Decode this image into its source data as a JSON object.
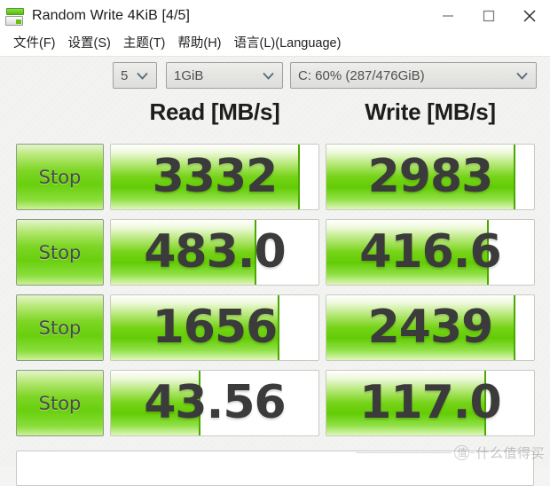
{
  "window": {
    "title": "Random Write 4KiB [4/5]",
    "icon": "disk-drive-icon",
    "controls": {
      "minimize": "minimize-icon",
      "maximize": "maximize-icon",
      "close": "close-icon"
    }
  },
  "menu": {
    "items": [
      {
        "label": "文件(F)"
      },
      {
        "label": "设置(S)"
      },
      {
        "label": "主题(T)"
      },
      {
        "label": "帮助(H)"
      },
      {
        "label": "语言(L)(Language)"
      }
    ]
  },
  "toolbar": {
    "runs": {
      "value": "5"
    },
    "size": {
      "value": "1GiB"
    },
    "drive": {
      "value": "C: 60% (287/476GiB)"
    }
  },
  "headers": {
    "read": "Read [MB/s]",
    "write": "Write [MB/s]"
  },
  "rows": [
    {
      "stop_label": "Stop",
      "read": {
        "value": "3332",
        "fill_percent": 91
      },
      "write": {
        "value": "2983",
        "fill_percent": 91
      }
    },
    {
      "stop_label": "Stop",
      "read": {
        "value": "483.0",
        "fill_percent": 70
      },
      "write": {
        "value": "416.6",
        "fill_percent": 78
      }
    },
    {
      "stop_label": "Stop",
      "read": {
        "value": "1656",
        "fill_percent": 81
      },
      "write": {
        "value": "2439",
        "fill_percent": 91
      }
    },
    {
      "stop_label": "Stop",
      "read": {
        "value": "43.56",
        "fill_percent": 43
      },
      "write": {
        "value": "117.0",
        "fill_percent": 77
      }
    }
  ],
  "watermark": {
    "mark": "值",
    "text": "什么值得买"
  },
  "colors": {
    "accent_green": "#69cf0d",
    "fill_edge": "#4aa800",
    "text_dark": "#3b3b3b",
    "background": "#f3f3f1"
  }
}
